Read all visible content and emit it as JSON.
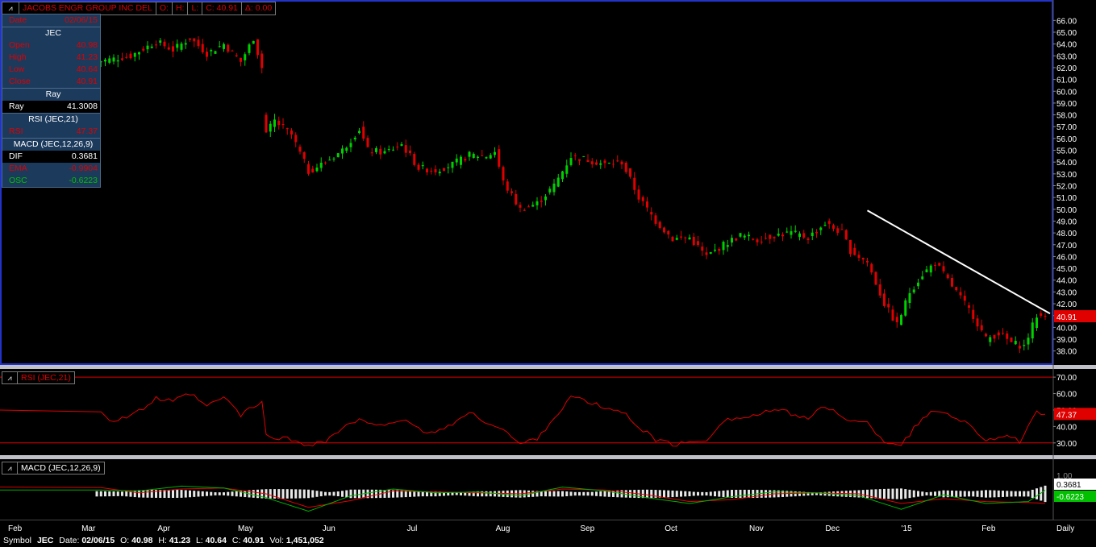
{
  "header": {
    "symbol_name": "JACOBS ENGR GROUP INC DEL",
    "open_label": "O:",
    "high_label": "H:",
    "low_label": "L:",
    "close_text": "C: 40.91",
    "change_text": "Δ: 0.00"
  },
  "data_window": {
    "date_label": "Date",
    "date_value": "02/06/15",
    "symbol": "JEC",
    "open_label": "Open",
    "open_value": "40.98",
    "high_label": "High",
    "high_value": "41.23",
    "low_label": "Low",
    "low_value": "40.64",
    "close_label": "Close",
    "close_value": "40.91",
    "ray_header": "Ray",
    "ray_label": "Ray",
    "ray_value": "41.3008",
    "rsi_header": "RSI (JEC,21)",
    "rsi_label": "RSI",
    "rsi_value": "47.37",
    "macd_header": "MACD (JEC,12,26,9)",
    "dif_label": "DIF",
    "dif_value": "0.3681",
    "ema_label": "EMA",
    "ema_value": "-0.9904",
    "osc_label": "OSC",
    "osc_value": "-0.6223"
  },
  "rsi_panel": {
    "title": "RSI (JEC,21)",
    "value_tag": "47.37"
  },
  "macd_panel": {
    "title": "MACD (JEC,12,26,9)",
    "dif_tag": "0.3681",
    "osc_tag": "-0.6223",
    "partial_tick": "1.00"
  },
  "price_tag": "40.91",
  "status_bar": {
    "symbol_label": "Symbol",
    "symbol": "JEC",
    "date_label": "Date:",
    "date": "02/06/15",
    "o_label": "O:",
    "o": "40.98",
    "h_label": "H:",
    "h": "41.23",
    "l_label": "L:",
    "l": "40.64",
    "c_label": "C:",
    "c": "40.91",
    "vol_label": "Vol:",
    "vol": "1,451,052"
  },
  "colors": {
    "up": "#00d000",
    "down": "#e00000",
    "rsi": "#e00000",
    "dif": "#00b000",
    "ema": "#e00000",
    "frame": "#2233cc",
    "trend": "#ffffff"
  },
  "chart_data": [
    {
      "type": "candlestick",
      "title": "JACOBS ENGR GROUP INC DEL",
      "x_labels": [
        "Feb",
        "Mar",
        "Apr",
        "May",
        "Jun",
        "Jul",
        "Aug",
        "Sep",
        "Oct",
        "Nov",
        "Dec",
        "'15",
        "Feb",
        "Daily"
      ],
      "y_ticks": [
        "66.00",
        "65.00",
        "64.00",
        "63.00",
        "62.00",
        "61.00",
        "60.00",
        "59.00",
        "58.00",
        "57.00",
        "56.00",
        "55.00",
        "54.00",
        "53.00",
        "52.00",
        "51.00",
        "50.00",
        "49.00",
        "48.00",
        "47.00",
        "46.00",
        "45.00",
        "44.00",
        "43.00",
        "42.00",
        "41.00",
        "40.00",
        "39.00",
        "38.00"
      ],
      "ylim": [
        37.5,
        66.5
      ],
      "close_path": [
        [
          0,
          62.5
        ],
        [
          8,
          63.0
        ],
        [
          14,
          64.2
        ],
        [
          18,
          63.5
        ],
        [
          22,
          64.5
        ],
        [
          26,
          63.2
        ],
        [
          30,
          64.0
        ],
        [
          34,
          62.5
        ],
        [
          37,
          64.5
        ],
        [
          39,
          62.0
        ],
        [
          40,
          56.5
        ],
        [
          42,
          57.5
        ],
        [
          46,
          56.3
        ],
        [
          50,
          53.2
        ],
        [
          54,
          54.0
        ],
        [
          58,
          55.0
        ],
        [
          62,
          56.8
        ],
        [
          64,
          55.0
        ],
        [
          68,
          54.8
        ],
        [
          72,
          55.5
        ],
        [
          76,
          53.5
        ],
        [
          80,
          53.3
        ],
        [
          84,
          53.8
        ],
        [
          88,
          54.6
        ],
        [
          92,
          54.5
        ],
        [
          94,
          54.9
        ],
        [
          96,
          52.3
        ],
        [
          100,
          50.0
        ],
        [
          104,
          50.5
        ],
        [
          108,
          52.0
        ],
        [
          112,
          54.5
        ],
        [
          116,
          54.2
        ],
        [
          120,
          53.8
        ],
        [
          124,
          54.0
        ],
        [
          128,
          51.0
        ],
        [
          132,
          49.0
        ],
        [
          136,
          47.5
        ],
        [
          140,
          47.6
        ],
        [
          144,
          46.0
        ],
        [
          148,
          47.0
        ],
        [
          152,
          47.8
        ],
        [
          156,
          47.4
        ],
        [
          160,
          47.8
        ],
        [
          164,
          48.0
        ],
        [
          168,
          47.6
        ],
        [
          172,
          48.8
        ],
        [
          176,
          48.0
        ],
        [
          178,
          46.5
        ],
        [
          182,
          45.5
        ],
        [
          186,
          42.0
        ],
        [
          189,
          40.2
        ],
        [
          192,
          43.0
        ],
        [
          195,
          44.5
        ],
        [
          198,
          45.5
        ],
        [
          201,
          44.0
        ],
        [
          204,
          42.5
        ],
        [
          207,
          41.0
        ],
        [
          210,
          39.0
        ],
        [
          213,
          39.5
        ],
        [
          216,
          38.7
        ],
        [
          219,
          38.4
        ],
        [
          222,
          41.0
        ],
        [
          224,
          40.91
        ]
      ],
      "ray": {
        "from": [
          182,
          49.9
        ],
        "to": [
          224,
          41.3008
        ]
      },
      "last": {
        "open": 40.98,
        "high": 41.23,
        "low": 40.64,
        "close": 40.91
      }
    },
    {
      "type": "line",
      "title": "RSI (JEC,21)",
      "y_ticks": [
        "70.00",
        "60.00",
        "50.00",
        "40.00",
        "30.00"
      ],
      "levels": [
        70,
        30
      ],
      "ylim": [
        25,
        73
      ],
      "series": [
        {
          "name": "RSI",
          "values": [
            [
              0,
              51
            ],
            [
              4,
              43
            ],
            [
              10,
              49
            ],
            [
              14,
              57
            ],
            [
              18,
              55
            ],
            [
              22,
              60
            ],
            [
              26,
              52
            ],
            [
              30,
              58
            ],
            [
              34,
              47
            ],
            [
              39,
              55
            ],
            [
              40,
              34
            ],
            [
              44,
              33
            ],
            [
              50,
              29
            ],
            [
              54,
              31
            ],
            [
              58,
              39
            ],
            [
              62,
              44
            ],
            [
              64,
              41
            ],
            [
              68,
              42
            ],
            [
              72,
              44
            ],
            [
              76,
              38
            ],
            [
              80,
              36
            ],
            [
              84,
              42
            ],
            [
              88,
              48
            ],
            [
              92,
              43
            ],
            [
              96,
              38
            ],
            [
              100,
              29
            ],
            [
              104,
              33
            ],
            [
              108,
              45
            ],
            [
              112,
              58
            ],
            [
              116,
              55
            ],
            [
              120,
              51
            ],
            [
              124,
              49
            ],
            [
              128,
              40
            ],
            [
              132,
              32
            ],
            [
              136,
              29
            ],
            [
              140,
              30
            ],
            [
              144,
              32
            ],
            [
              148,
              44
            ],
            [
              152,
              45
            ],
            [
              156,
              47
            ],
            [
              160,
              50
            ],
            [
              164,
              48
            ],
            [
              168,
              45
            ],
            [
              172,
              52
            ],
            [
              176,
              47
            ],
            [
              178,
              43
            ],
            [
              182,
              42
            ],
            [
              186,
              31
            ],
            [
              190,
              29
            ],
            [
              194,
              42
            ],
            [
              198,
              50
            ],
            [
              202,
              47
            ],
            [
              206,
              41
            ],
            [
              210,
              32
            ],
            [
              214,
              34
            ],
            [
              218,
              31
            ],
            [
              222,
              48
            ],
            [
              224,
              47.37
            ]
          ]
        }
      ]
    },
    {
      "type": "macd",
      "title": "MACD (JEC,12,26,9)",
      "series": [
        {
          "name": "DIF",
          "values": [
            [
              0,
              0.4
            ],
            [
              10,
              0.3
            ],
            [
              20,
              0.8
            ],
            [
              30,
              0.6
            ],
            [
              40,
              -0.4
            ],
            [
              50,
              -1.8
            ],
            [
              60,
              -0.2
            ],
            [
              70,
              0.5
            ],
            [
              80,
              0.1
            ],
            [
              90,
              0.2
            ],
            [
              100,
              -0.2
            ],
            [
              110,
              0.7
            ],
            [
              120,
              0.3
            ],
            [
              130,
              -0.4
            ],
            [
              140,
              -1.0
            ],
            [
              150,
              -0.3
            ],
            [
              160,
              0.2
            ],
            [
              170,
              0.1
            ],
            [
              180,
              -0.2
            ],
            [
              190,
              -1.6
            ],
            [
              200,
              -0.1
            ],
            [
              210,
              -1.0
            ],
            [
              220,
              -0.8
            ],
            [
              224,
              0.3681
            ]
          ]
        },
        {
          "name": "EMA",
          "values": [
            [
              0,
              0.7
            ],
            [
              10,
              0.1
            ],
            [
              20,
              0.5
            ],
            [
              30,
              0.6
            ],
            [
              40,
              0.0
            ],
            [
              50,
              -1.4
            ],
            [
              60,
              -0.7
            ],
            [
              70,
              0.3
            ],
            [
              80,
              0.2
            ],
            [
              90,
              0.1
            ],
            [
              100,
              0.0
            ],
            [
              110,
              0.5
            ],
            [
              120,
              0.4
            ],
            [
              130,
              -0.1
            ],
            [
              140,
              -0.8
            ],
            [
              150,
              -0.6
            ],
            [
              160,
              0.0
            ],
            [
              170,
              0.1
            ],
            [
              180,
              0.0
            ],
            [
              190,
              -1.0
            ],
            [
              200,
              -0.5
            ],
            [
              210,
              -0.8
            ],
            [
              220,
              -0.9
            ],
            [
              224,
              -0.9904
            ]
          ]
        }
      ],
      "osc_last": -0.6223
    }
  ]
}
